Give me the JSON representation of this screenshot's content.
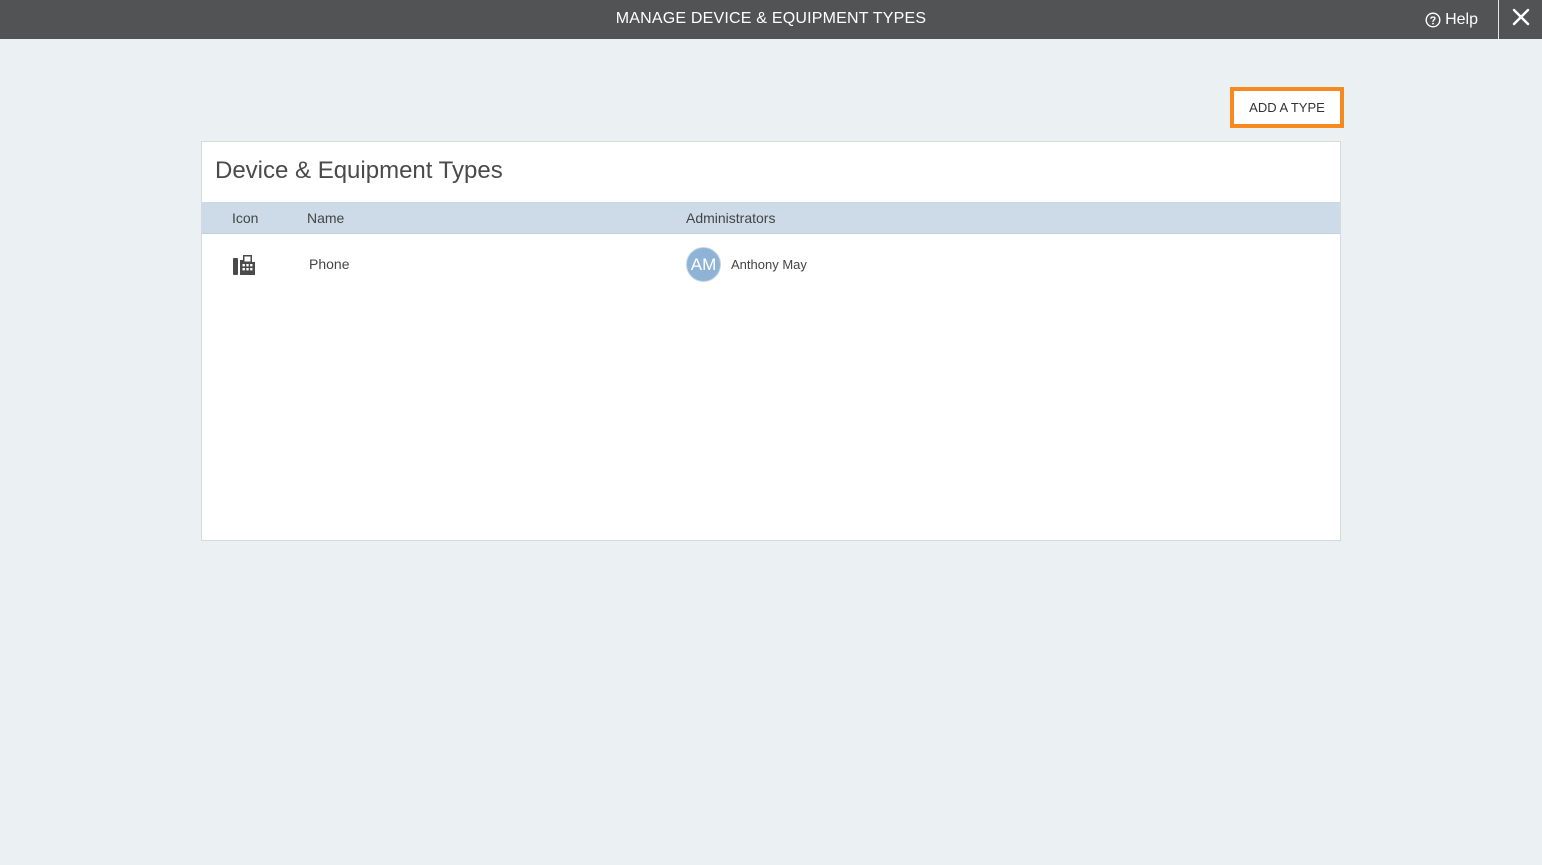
{
  "header": {
    "title": "MANAGE DEVICE & EQUIPMENT TYPES",
    "help_label": "Help",
    "help_icon": "question-circle-icon",
    "close_icon": "close-icon"
  },
  "actions": {
    "add_type_label": "ADD A TYPE",
    "highlight_color": "#f7891f"
  },
  "panel": {
    "title": "Device & Equipment Types",
    "columns": [
      "Icon",
      "Name",
      "Administrators"
    ],
    "rows": [
      {
        "icon": "fax-phone-icon",
        "name": "Phone",
        "administrator": {
          "initials": "AM",
          "name": "Anthony May"
        }
      }
    ]
  }
}
